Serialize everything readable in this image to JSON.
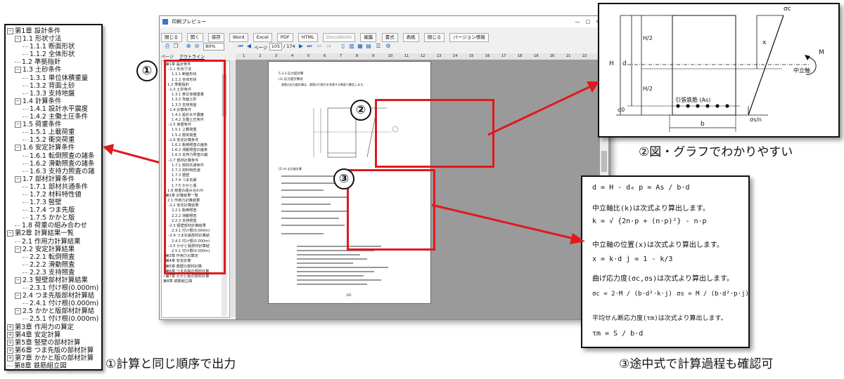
{
  "outline": {
    "items": [
      {
        "depth": 0,
        "expander": "−",
        "label": "第1章 設計条件"
      },
      {
        "depth": 1,
        "expander": "−",
        "label": "1.1 形状寸法"
      },
      {
        "depth": 2,
        "expander": "",
        "label": "1.1.1 断面形状"
      },
      {
        "depth": 2,
        "expander": "",
        "label": "1.1.2 全体形状"
      },
      {
        "depth": 1,
        "expander": "",
        "label": "1.2 準拠指針"
      },
      {
        "depth": 1,
        "expander": "−",
        "label": "1.3 土砂条件"
      },
      {
        "depth": 2,
        "expander": "",
        "label": "1.3.1 単位体積重量"
      },
      {
        "depth": 2,
        "expander": "",
        "label": "1.3.2 背面土砂"
      },
      {
        "depth": 2,
        "expander": "",
        "label": "1.3.3 支持地盤"
      },
      {
        "depth": 1,
        "expander": "−",
        "label": "1.4 計算条件"
      },
      {
        "depth": 2,
        "expander": "",
        "label": "1.4.1 設計水平震度"
      },
      {
        "depth": 2,
        "expander": "",
        "label": "1.4.2 主働土圧条件"
      },
      {
        "depth": 1,
        "expander": "−",
        "label": "1.5 荷重条件"
      },
      {
        "depth": 2,
        "expander": "",
        "label": "1.5.1 上載荷重"
      },
      {
        "depth": 2,
        "expander": "",
        "label": "1.5.2 衝突荷重"
      },
      {
        "depth": 1,
        "expander": "−",
        "label": "1.6 安定計算条件"
      },
      {
        "depth": 2,
        "expander": "",
        "label": "1.6.1 転倒照査の諸条"
      },
      {
        "depth": 2,
        "expander": "",
        "label": "1.6.2 滑動照査の諸条"
      },
      {
        "depth": 2,
        "expander": "",
        "label": "1.6.3 支持力照査の諸"
      },
      {
        "depth": 1,
        "expander": "−",
        "label": "1.7 部材計算条件"
      },
      {
        "depth": 2,
        "expander": "",
        "label": "1.7.1 部材共通条件"
      },
      {
        "depth": 2,
        "expander": "",
        "label": "1.7.2 材料特性値"
      },
      {
        "depth": 2,
        "expander": "",
        "label": "1.7.3 竪壁"
      },
      {
        "depth": 2,
        "expander": "",
        "label": "1.7.4 つま先版"
      },
      {
        "depth": 2,
        "expander": "",
        "label": "1.7.5 かかと版"
      },
      {
        "depth": 1,
        "expander": "",
        "label": "1.8 荷重の組み合わせ"
      },
      {
        "depth": 0,
        "expander": "−",
        "label": "第2章 計算結果一覧"
      },
      {
        "depth": 1,
        "expander": "",
        "label": "2.1 作用力計算結果"
      },
      {
        "depth": 1,
        "expander": "−",
        "label": "2.2 安定計算結果"
      },
      {
        "depth": 2,
        "expander": "",
        "label": "2.2.1 転倒照査"
      },
      {
        "depth": 2,
        "expander": "",
        "label": "2.2.2 滑動照査"
      },
      {
        "depth": 2,
        "expander": "",
        "label": "2.2.3 支持照査"
      },
      {
        "depth": 1,
        "expander": "−",
        "label": "2.3 竪壁部材計算結果"
      },
      {
        "depth": 2,
        "expander": "",
        "label": "2.3.1 付け根(0.000m)"
      },
      {
        "depth": 1,
        "expander": "−",
        "label": "2.4 つま先版部材計算結"
      },
      {
        "depth": 2,
        "expander": "",
        "label": "2.4.1 付け根(0.000m)"
      },
      {
        "depth": 1,
        "expander": "−",
        "label": "2.5 かかと版部材計算結"
      },
      {
        "depth": 2,
        "expander": "",
        "label": "2.5.1 付け根(0.000m)"
      },
      {
        "depth": 0,
        "expander": "+",
        "label": "第3章 作用力の算定"
      },
      {
        "depth": 0,
        "expander": "+",
        "label": "第4章 安定計算"
      },
      {
        "depth": 0,
        "expander": "+",
        "label": "第5章 竪壁の部材計算"
      },
      {
        "depth": 0,
        "expander": "+",
        "label": "第6章 つま先版の部材計算"
      },
      {
        "depth": 0,
        "expander": "+",
        "label": "第7章 かかと版の部材計算"
      },
      {
        "depth": 0,
        "expander": "",
        "label": "第8章 鉄筋組立図"
      }
    ]
  },
  "window": {
    "title": "印刷プレビュー",
    "menu": [
      "閉じる",
      "開く",
      "保存",
      "Word",
      "Excel",
      "PDF",
      "HTML",
      "DocuWorks",
      "編集",
      "書式",
      "表紙",
      "閉じる",
      "バージョン情報"
    ],
    "zoom": "80%",
    "page_label": "ページ",
    "page_current": "105",
    "page_total": "/ 174",
    "tabs": [
      "ページ",
      "アウトライン"
    ],
    "ruler": [
      "1",
      "2",
      "3",
      "4",
      "5",
      "6",
      "7",
      "8",
      "9",
      "10",
      "11",
      "12",
      "13",
      "14",
      "15",
      "16",
      "17",
      "18",
      "19",
      "20",
      "21",
      "22"
    ]
  },
  "document_page": {
    "section": "5.3.3 応力度計算",
    "subsection": "(1) 応力度計算式",
    "intro": "鉄筋の応力度計算は、鉄筋の引張力を考慮する断面で算定します。",
    "formula_heading": "(2) σc 応力度計算",
    "page_number": "105"
  },
  "figure": {
    "sigma_c": "σc",
    "sigma_s": "σs/n",
    "label_H": "H",
    "label_d": "d",
    "label_H2a": "H/2",
    "label_H2b": "H/2",
    "label_d0": "d0",
    "label_x": "x",
    "label_M": "M",
    "neutral_axis": "中立軸",
    "tension_bar": "引張鉄筋 (As)",
    "label_b": "b"
  },
  "formulas": {
    "line1": "d = H - d₀     p = As / b·d",
    "line2": "中立軸比(k)は次式より算出します。",
    "line3": "k = √ {2n·p + (n·p)²} - n·p",
    "line4": "中立軸の位置(x)は次式より算出します。",
    "line5": "x = k·d       j = 1 - k/3",
    "line6": "曲げ応力度(σc,σs)は次式より算出します。",
    "line7a": "σc = 2·M / (b·d²·k·j)",
    "line7b": "σs = M / (b·d²·p·j)",
    "line8": "平均せん断応力度(τm)は次式より算出します。",
    "line9": "τm = S / b·d"
  },
  "annotations": {
    "num1": "①",
    "num2": "②",
    "num3": "③",
    "caption1": "①計算と同じ順序で出力",
    "caption2": "②図・グラフでわかりやすい",
    "caption3": "③途中式で計算過程も確認可"
  },
  "colors": {
    "accent_red": "#e0191d"
  }
}
